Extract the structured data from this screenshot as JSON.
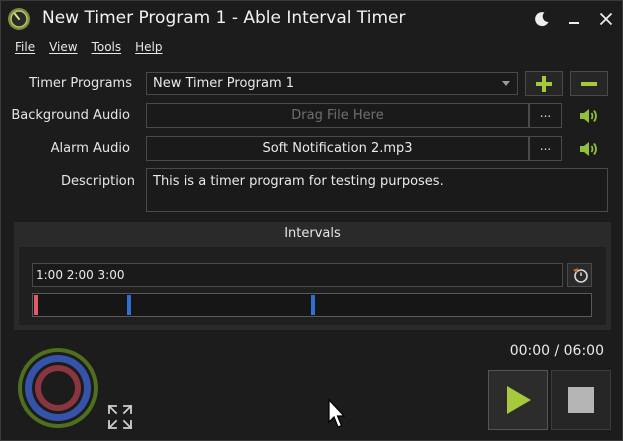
{
  "window": {
    "title": "New Timer Program 1 - Able Interval Timer"
  },
  "menu": [
    "File",
    "View",
    "Tools",
    "Help"
  ],
  "form": {
    "timer_programs_label": "Timer Programs",
    "timer_program_value": "New Timer Program 1",
    "background_audio_label": "Background Audio",
    "background_audio_placeholder": "Drag File Here",
    "alarm_audio_label": "Alarm Audio",
    "alarm_audio_value": "Soft Notification 2.mp3",
    "description_label": "Description",
    "description_value": "This is a timer program for testing purposes.",
    "browse_label": "..."
  },
  "intervals": {
    "title": "Intervals",
    "input_value": "1:00 2:00 3:00",
    "ticks": [
      {
        "position": 0.0,
        "color": "#e05a6a"
      },
      {
        "position": 0.167,
        "color": "#2f6fd0"
      },
      {
        "position": 0.5,
        "color": "#2f6fd0"
      }
    ]
  },
  "timer": {
    "elapsed_total": "00:00 / 06:00"
  },
  "colors": {
    "accent_green": "#a7c93c",
    "speaker_green": "#8fc13a",
    "ring_outer": "#4f6f1c",
    "ring_mid": "#3553a8",
    "ring_inner": "#8a3540"
  },
  "icons": {
    "app": "stopwatch-icon",
    "night_mode": "moon-icon",
    "minimize": "minimize-icon",
    "close": "close-icon",
    "add": "plus-icon",
    "remove": "minus-icon",
    "volume": "speaker-icon",
    "interval_edit": "timer-settings-icon",
    "expand": "expand-icon",
    "play": "play-icon",
    "stop": "stop-icon"
  }
}
